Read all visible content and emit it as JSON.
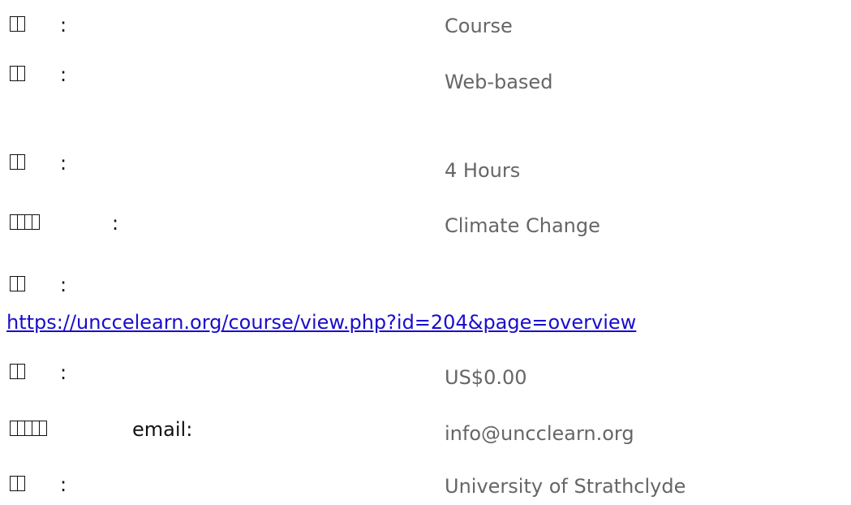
{
  "rows": [
    {
      "label_chars": 2,
      "sep": ":",
      "value": "Course"
    },
    {
      "label_chars": 2,
      "sep": ":",
      "value": "Web-based"
    },
    {
      "label_chars": 2,
      "sep": ":",
      "value": "4 Hours"
    },
    {
      "label_chars": 4,
      "sep": ":",
      "value": "Climate Change"
    },
    {
      "label_chars": 2,
      "sep": ":",
      "value": ""
    },
    {
      "label_chars": 2,
      "sep": ":",
      "value": "US$0.00"
    },
    {
      "label_chars": 5,
      "sep": "email:",
      "value": "info@uncclearn.org"
    },
    {
      "label_chars": 2,
      "sep": ":",
      "value": "University of Strathclyde"
    }
  ],
  "link": {
    "url_text": "https://unccelearn.org/course/view.php?id=204&page=overview"
  }
}
